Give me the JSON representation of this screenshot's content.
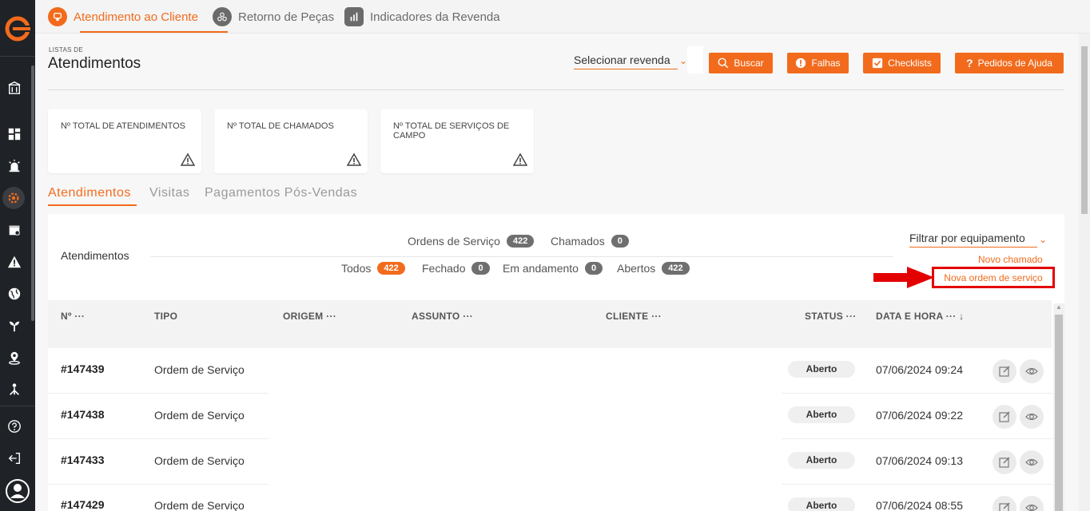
{
  "colors": {
    "accent": "#f26b1d",
    "sidebar": "#1f2226",
    "highlight": "#e30000"
  },
  "top_tabs": [
    {
      "label": "Atendimento ao Cliente",
      "icon": "headset-icon"
    },
    {
      "label": "Retorno de Peças",
      "icon": "parts-icon"
    },
    {
      "label": "Indicadores da Revenda",
      "icon": "bar-chart-icon"
    }
  ],
  "header": {
    "subtitle": "LISTAS DE",
    "title": "Atendimentos",
    "revenda_select": "Selecionar revenda",
    "buttons": {
      "buscar": "Buscar",
      "falhas": "Falhas",
      "checklists": "Checklists",
      "pedidos": "Pedidos de Ajuda"
    }
  },
  "cards": [
    {
      "label": "Nº TOTAL DE ATENDIMENTOS"
    },
    {
      "label": "Nº TOTAL DE CHAMADOS"
    },
    {
      "label": "Nº TOTAL DE SERVIÇOS DE CAMPO"
    }
  ],
  "sub_tabs": [
    "Atendimentos",
    "Visitas",
    "Pagamentos Pós-Vendas"
  ],
  "panel": {
    "title": "Atendimentos",
    "type_filters": [
      {
        "label": "Ordens de Serviço",
        "count": "422"
      },
      {
        "label": "Chamados",
        "count": "0"
      }
    ],
    "status_filters": [
      {
        "label": "Todos",
        "count": "422"
      },
      {
        "label": "Fechado",
        "count": "0"
      },
      {
        "label": "Em andamento",
        "count": "0"
      },
      {
        "label": "Abertos",
        "count": "422"
      }
    ],
    "equipment_filter": "Filtrar por equipamento",
    "novo_chamado": "Novo chamado",
    "nova_ordem": "Nova ordem de serviço"
  },
  "table": {
    "columns": [
      "Nº",
      "TIPO",
      "ORIGEM",
      "ASSUNTO",
      "CLIENTE",
      "STATUS",
      "DATA E HORA"
    ],
    "rows": [
      {
        "num": "#147439",
        "tipo": "Ordem de Serviço",
        "status": "Aberto",
        "data": "07/06/2024 09:24"
      },
      {
        "num": "#147438",
        "tipo": "Ordem de Serviço",
        "status": "Aberto",
        "data": "07/06/2024 09:22"
      },
      {
        "num": "#147433",
        "tipo": "Ordem de Serviço",
        "status": "Aberto",
        "data": "07/06/2024 09:13"
      },
      {
        "num": "#147429",
        "tipo": "Ordem de Serviço",
        "status": "Aberto",
        "data": "07/06/2024 08:55"
      }
    ]
  }
}
